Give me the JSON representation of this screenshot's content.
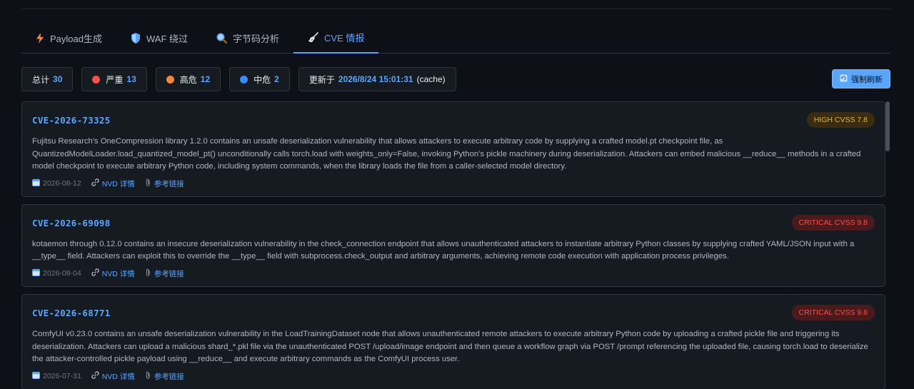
{
  "tabs": [
    {
      "label": "Payload生成",
      "icon": "lightning-icon"
    },
    {
      "label": "WAF 绕过",
      "icon": "shield-icon"
    },
    {
      "label": "字节码分析",
      "icon": "magnifier-icon"
    },
    {
      "label": "CVE 情报",
      "icon": "broom-icon"
    }
  ],
  "active_tab": 3,
  "stats": {
    "total_label": "总计",
    "total": "30",
    "critical_label": "严重",
    "critical": "13",
    "high_label": "高危",
    "high": "12",
    "medium_label": "中危",
    "medium": "2",
    "updated_label": "更新于",
    "updated": "2026/8/24 15:01:31",
    "cache": "(cache)"
  },
  "refresh_label": "强制刷新",
  "colors": {
    "critical": "#f85149",
    "high": "#f0883e",
    "medium": "#388bfd",
    "accent": "#58a6ff"
  },
  "nvd_label": "NVD 详情",
  "ref_label": "参考链接",
  "cves": [
    {
      "id": "CVE-2026-73325",
      "severity": "HIGH CVSS 7.8",
      "level": "high",
      "description": "Fujitsu Research's OneCompression library 1.2.0 contains an unsafe deserialization vulnerability that allows attackers to execute arbitrary code by supplying a crafted model.pt checkpoint file, as QuantizedModelLoader.load_quantized_model_pt() unconditionally calls torch.load with weights_only=False, invoking Python's pickle machinery during deserialization. Attackers can embed malicious __reduce__ methods in a crafted model checkpoint to execute arbitrary Python code, including system commands, when the library loads the file from a caller-selected model directory.",
      "date": "2026-08-12"
    },
    {
      "id": "CVE-2026-69098",
      "severity": "CRITICAL CVSS 9.8",
      "level": "critical",
      "description": "kotaemon through 0.12.0 contains an insecure deserialization vulnerability in the check_connection endpoint that allows unauthenticated attackers to instantiate arbitrary Python classes by supplying crafted YAML/JSON input with a __type__ field. Attackers can exploit this to override the __type__ field with subprocess.check_output and arbitrary arguments, achieving remote code execution with application process privileges.",
      "date": "2026-08-04"
    },
    {
      "id": "CVE-2026-68771",
      "severity": "CRITICAL CVSS 9.8",
      "level": "critical",
      "description": "ComfyUI v0.23.0 contains an unsafe deserialization vulnerability in the LoadTrainingDataset node that allows unauthenticated remote attackers to execute arbitrary Python code by uploading a crafted pickle file and triggering its deserialization. Attackers can upload a malicious shard_*.pkl file via the unauthenticated POST /upload/image endpoint and then queue a workflow graph via POST /prompt referencing the uploaded file, causing torch.load to deserialize the attacker-controlled pickle payload using __reduce__ and execute arbitrary commands as the ComfyUI process user.",
      "date": "2026-07-31"
    }
  ]
}
